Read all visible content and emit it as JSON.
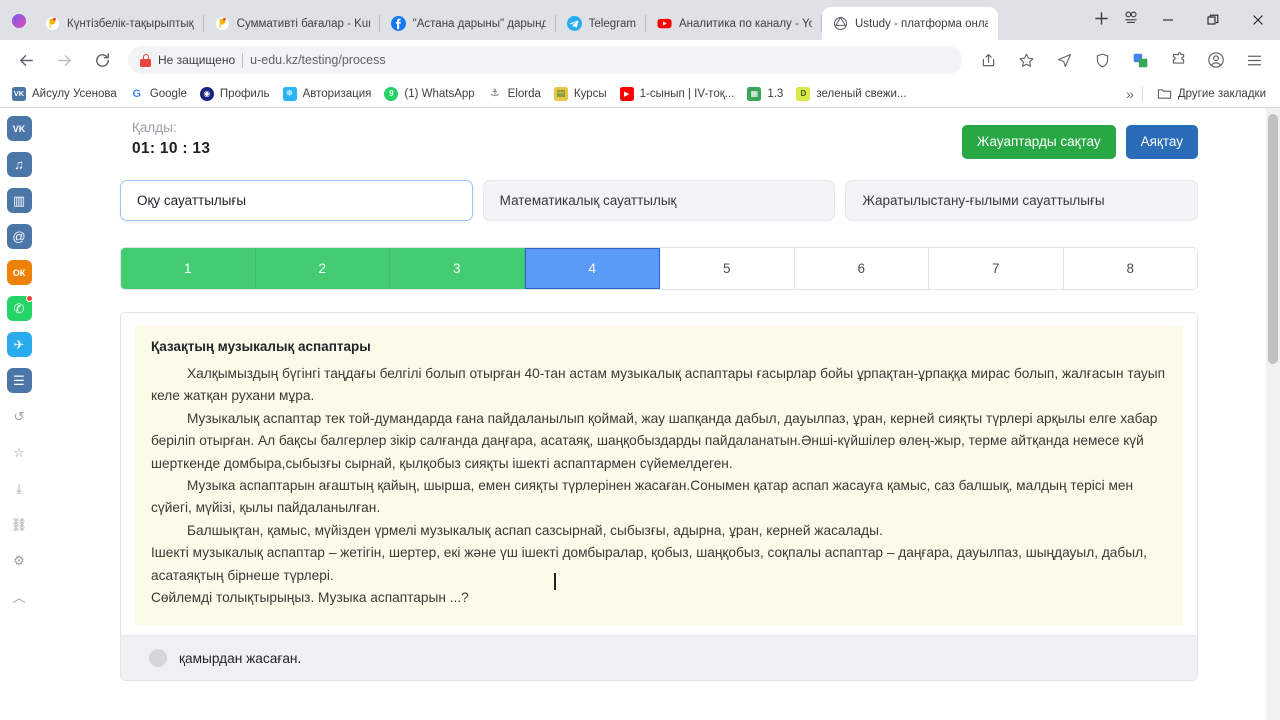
{
  "browser": {
    "tabs": [
      {
        "label": "Күнтізбелік-тақырыптық",
        "icon": "ustudy-icon",
        "color": "#f5c518",
        "active": false
      },
      {
        "label": "Суммативті бағалар - Kun",
        "icon": "ustudy-icon",
        "color": "#f5c518",
        "active": false
      },
      {
        "label": "\"Астана дарыны\" дарынд",
        "icon": "facebook-icon",
        "color": "#1877f2",
        "active": false
      },
      {
        "label": "Telegram",
        "icon": "telegram-icon",
        "color": "#2aabee",
        "active": false
      },
      {
        "label": "Аналитика по каналу - Yo",
        "icon": "youtube-icon",
        "color": "#ff0000",
        "active": false
      },
      {
        "label": "Ustudy - платформа онла",
        "icon": "ustudy-globe-icon",
        "color": "#5f6368",
        "active": true
      }
    ],
    "new_tab_label": "+",
    "window_controls": {
      "minimize": "—",
      "maximize": "❐",
      "close": "✕"
    },
    "omnibox": {
      "security_label": "Не защищено",
      "url": "u-edu.kz/testing/process"
    },
    "bookmarks": [
      {
        "label": "Айсулу Усенова",
        "glyph": "VK",
        "color": "#4a76a8"
      },
      {
        "label": "Google",
        "glyph": "G",
        "color": "#ffffff"
      },
      {
        "label": "Профиль",
        "glyph": "◉",
        "color": "#1a237e"
      },
      {
        "label": "Авторизация",
        "glyph": "✵",
        "color": "#29b6f6"
      },
      {
        "label": "(1) WhatsApp",
        "glyph": "9",
        "color": "#25d366"
      },
      {
        "label": "Elorda",
        "glyph": "⚓",
        "color": "#ffffff"
      },
      {
        "label": "Курсы",
        "glyph": "▤",
        "color": "#e8c547"
      },
      {
        "label": "1-сынып | IV-тоқ...",
        "glyph": "▶",
        "color": "#ff0000"
      },
      {
        "label": "1.3",
        "glyph": "▦",
        "color": "#3ba55c"
      },
      {
        "label": "зеленый свежи...",
        "glyph": "D",
        "color": "#d9e84a"
      }
    ],
    "bookmarks_overflow": "»",
    "other_bookmarks": "Другие закладки"
  },
  "rail": [
    {
      "name": "vk-icon",
      "glyph": "VK",
      "color": "#4a76a8",
      "badge": false
    },
    {
      "name": "music-icon",
      "glyph": "♫",
      "color": "#4a76a8",
      "badge": false
    },
    {
      "name": "stats-icon",
      "glyph": "▥",
      "color": "#4a76a8",
      "badge": false
    },
    {
      "name": "mail-icon",
      "glyph": "@",
      "color": "#4a76a8",
      "badge": false
    },
    {
      "name": "odnoklassniki-icon",
      "glyph": "ОК",
      "color": "#ee8208",
      "badge": false
    },
    {
      "name": "whatsapp-icon",
      "glyph": "✆",
      "color": "#25d366",
      "badge": true
    },
    {
      "name": "telegram-icon",
      "glyph": "✈",
      "color": "#2aabee",
      "badge": false
    },
    {
      "name": "feed-icon",
      "glyph": "☰",
      "color": "#4a76a8",
      "badge": false
    },
    {
      "name": "history-icon",
      "glyph": "↺",
      "color": "transparent",
      "badge": false
    },
    {
      "name": "bookmark-star-icon",
      "glyph": "☆",
      "color": "transparent",
      "badge": false
    },
    {
      "name": "download-icon",
      "glyph": "⤓",
      "color": "transparent",
      "badge": false
    },
    {
      "name": "link-icon",
      "glyph": "⛓",
      "color": "transparent",
      "badge": false
    },
    {
      "name": "settings-gear-icon",
      "glyph": "⚙",
      "color": "transparent",
      "badge": false
    },
    {
      "name": "collapse-up-icon",
      "glyph": "︿",
      "color": "transparent",
      "badge": false
    }
  ],
  "test": {
    "timer_label": "Қалды:",
    "timer_value": "01: 10 : 13",
    "save_button": "Жауаптарды сақтау",
    "finish_button": "Аяқтау",
    "save_color": "#28a745",
    "finish_color": "#2b6cb8",
    "subjects": [
      {
        "label": "Оқу сауаттылығы",
        "active": true
      },
      {
        "label": "Математикалық сауаттылық",
        "active": false
      },
      {
        "label": "Жаратылыстану-ғылыми сауаттылығы",
        "active": false
      }
    ],
    "question_numbers": [
      {
        "label": "1",
        "state": "done"
      },
      {
        "label": "2",
        "state": "done"
      },
      {
        "label": "3",
        "state": "done"
      },
      {
        "label": "4",
        "state": "active"
      },
      {
        "label": "5",
        "state": "empty"
      },
      {
        "label": "6",
        "state": "empty"
      },
      {
        "label": "7",
        "state": "empty"
      },
      {
        "label": "8",
        "state": "empty"
      }
    ],
    "state_colors": {
      "done": "#43cc70",
      "active": "#5b9bf8",
      "empty": "#ffffff"
    },
    "passage": {
      "title": "Қазақтың музыкалық аспаптары",
      "paragraphs": [
        "Халқымыздың бүгінгі таңдағы белгілі болып отырған 40-тан астам музыкалық аспаптары ғасырлар бойы ұрпақтан-ұрпаққа мирас болып, жалғасын тауып келе жатқан рухани мұра.",
        "Музыкалық аспаптар тек той-думандарда ғана пайдаланылып қоймай, жау шапқанда дабыл, дауылпаз, ұран, керней сияқты түрлері арқылы елге хабар беріліп отырған. Ал бақсы балгерлер зікір салғанда даңғара, асатаяқ, шаңқобыздарды пайдаланатын.Әнші-күйшілер өлең-жыр, терме айтқанда немесе күй шерткенде домбыра,сыбызғы сырнай, қылқобыз сияқты ішекті аспаптармен сүйемелдеген.",
        "Музыка аспаптарын ағаштың қайың, шырша, емен сияқты түрлерінен жасаған.Сонымен қатар аспап жасауға қамыс, саз балшық, малдың терісі мен сүйегі, мүйізі, қылы пайдаланылған.",
        "Балшықтан, қамыс, мүйізден үрмелі музыкалық аспап сазсырнай, сыбызғы, адырна, ұран, керней жасалады."
      ],
      "tail_lines": [
        "Ішекті музыкалық аспаптар – жетігін, шертер, екі және үш ішекті домбыралар, қобыз, шаңқобыз, соқпалы аспаптар – даңғара, дауылпаз, шыңдауыл, дабыл, асатаяқтың бірнеше түрлері.",
        "Сөйлемді толықтырыңыз. Музыка аспаптарын ...?"
      ],
      "background": "#fcfbe9"
    },
    "answers": [
      {
        "label": "қамырдан жасаған.",
        "selected": false
      }
    ]
  }
}
